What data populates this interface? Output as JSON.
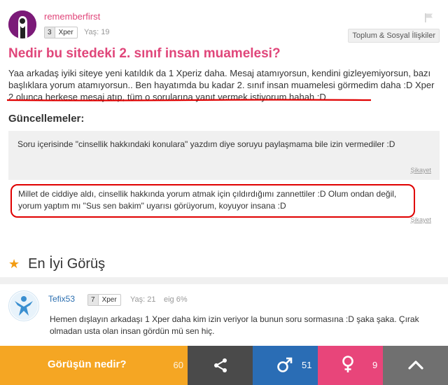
{
  "question": {
    "username": "rememberfirst",
    "level": "3",
    "level_label": "Xper",
    "age": "Yaş: 19",
    "category": "Toplum & Sosyal İlişkiler",
    "title": "Nedir bu sitedeki 2. sınıf insan muamelesi?",
    "body": "Yaa arkadaş iyiki siteye yeni katıldık da 1 Xperiz daha. Mesaj atamıyorsun, kendini gizleyemiyorsun, bazı başlıklara yorum atamıyorsun.. Ben hayatımda bu kadar 2. sınıf insan muamelesi görmedim daha :D Xper 2 olunca herkese mesaj atıp, tüm o sorularına yanıt vermek istiyorum hahah :D"
  },
  "updates": {
    "heading": "Güncellemeler:",
    "items": [
      {
        "text": "Soru içerisinde \"cinsellik hakkındaki konulara\" yazdım diye soruyu paylaşmama bile izin vermediler :D",
        "report": "Şikayet"
      },
      {
        "text": "Millet de ciddiye aldı, cinsellik hakkında yorum atmak için çıldırdığımı zannettiler :D Olum ondan değil, yorum yaptım mı \"Sus sen bakim\" uyarısı görüyorum, koyuyor insana :D",
        "report": "Şikayet"
      }
    ]
  },
  "best_answer": {
    "heading": "En İyi Görüş",
    "username": "Tefix53",
    "level": "7",
    "level_label": "Xper",
    "age": "Yaş: 21",
    "agreement": "eig 6%",
    "text": "Hemen dışlayın arkadaşı 1 Xper daha kim izin veriyor la bunun soru sormasına :D şaka şaka. Çırak olmadan usta olan insan gördün mü sen hiç."
  },
  "bottom_bar": {
    "opinion_label": "Görüşün nedir?",
    "opinion_count": "60",
    "male_count": "51",
    "female_count": "9"
  },
  "colors": {
    "accent_pink": "#e0467a",
    "orange": "#f5a623",
    "male_blue": "#2a6db5",
    "female_pink": "#e8457a",
    "dark_gray": "#4a4a4a",
    "annotation_red": "#e00000"
  },
  "icons": {
    "flag": "flag-icon",
    "star": "star-icon",
    "share": "share-icon",
    "male": "male-icon",
    "female": "female-icon",
    "up": "chevron-up-icon"
  }
}
